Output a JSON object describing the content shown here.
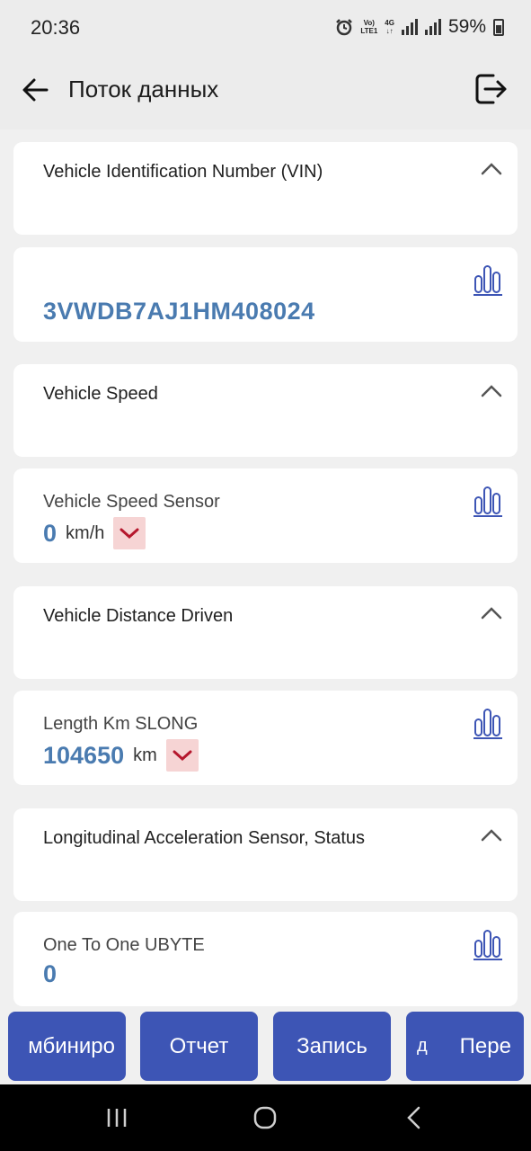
{
  "status_bar": {
    "time": "20:36",
    "net_top": "Vo)",
    "net_bottom": "LTE1",
    "net_type": "4G",
    "battery": "59%"
  },
  "header": {
    "title": "Поток данных",
    "back_icon": "arrow-left-icon",
    "exit_icon": "logout-icon"
  },
  "sections": [
    {
      "title": "Vehicle Identification Number (VIN)"
    },
    {
      "title": "Vehicle Speed"
    },
    {
      "title": "Vehicle Distance Driven"
    },
    {
      "title": "Longitudinal Acceleration Sensor, Status"
    }
  ],
  "items": [
    {
      "label": "",
      "value": "3VWDB7AJ1HM408024",
      "unit": ""
    },
    {
      "label": "Vehicle Speed Sensor",
      "value": "0",
      "unit": "km/h"
    },
    {
      "label": "Length Km SLONG",
      "value": "104650",
      "unit": "km"
    },
    {
      "label": "One To One UBYTE",
      "value": "0",
      "unit": ""
    }
  ],
  "actions": {
    "combine": "мбиниро",
    "report": "Отчет",
    "record": "Запись",
    "next_sub": "д",
    "next": "Пере"
  },
  "colors": {
    "accent": "#3d55b5",
    "value": "#4a7bb0",
    "dropdown_bg": "#f6d4d4",
    "dropdown_icon": "#b5172d"
  }
}
